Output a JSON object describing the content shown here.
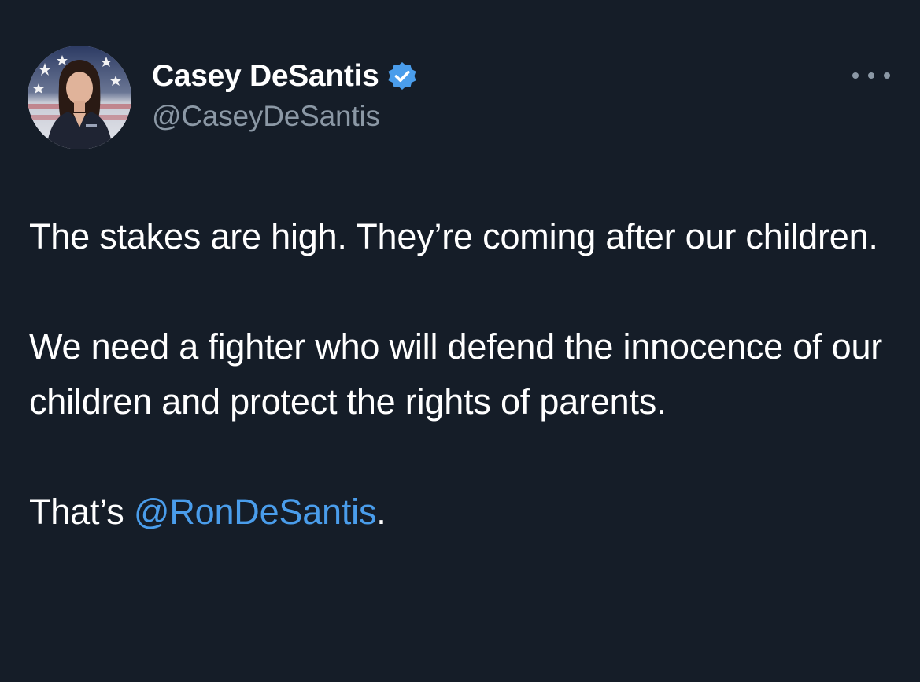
{
  "tweet": {
    "author": {
      "display_name": "Casey DeSantis",
      "handle": "@CaseyDeSantis",
      "verified_icon": "verified-badge-icon",
      "verified_color": "#4a9deb"
    },
    "more_icon": "more-options-icon",
    "body": {
      "paragraph_1": "The stakes are high. They’re coming after our children.",
      "paragraph_2": "We need a fighter who will defend the innocence of our children and protect the rights of parents.",
      "paragraph_3_prefix": "That’s ",
      "paragraph_3_mention": "@RonDeSantis",
      "paragraph_3_suffix": "."
    },
    "colors": {
      "background": "#151d28",
      "text": "#ffffff",
      "secondary_text": "#8b98a5",
      "link": "#4a9deb"
    }
  }
}
